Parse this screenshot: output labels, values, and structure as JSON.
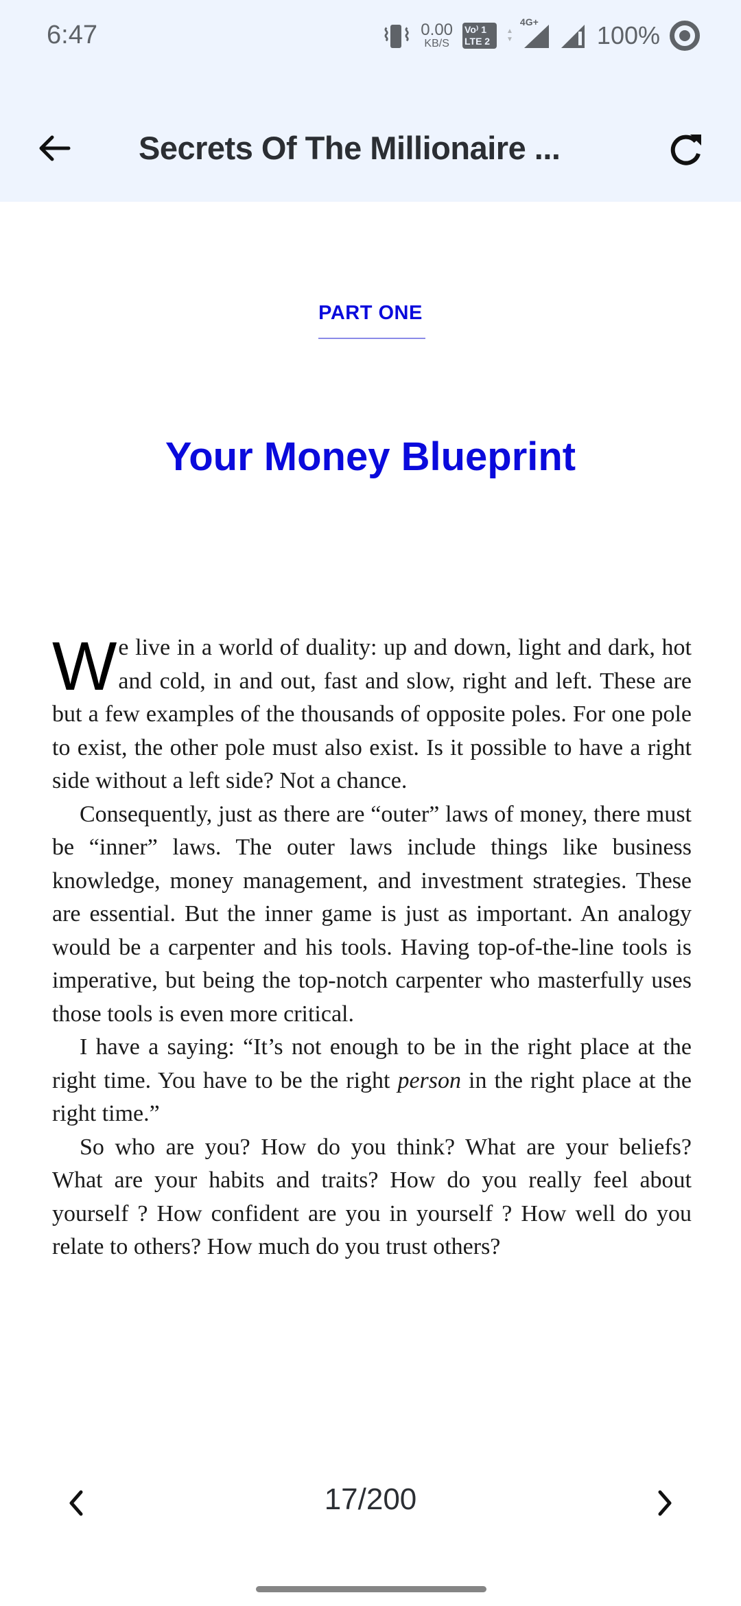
{
  "status_bar": {
    "time": "6:47",
    "net_speed_value": "0.00",
    "net_speed_unit": "KB/S",
    "volte_line1": "Vo⁾ 1",
    "volte_line2": "LTE 2",
    "network_type": "4G+",
    "battery_percent": "100%",
    "icons": [
      "vibrate-icon",
      "volte-icon",
      "data-arrows-icon",
      "signal-4g-icon",
      "signal-icon",
      "battery-saver-icon"
    ]
  },
  "app_bar": {
    "title": "Secrets Of The Millionaire ...",
    "back_icon": "arrow-left-icon",
    "refresh_icon": "refresh-icon"
  },
  "page": {
    "part_label": "PART ONE",
    "chapter_title": "Your Money Blueprint",
    "dropcap": "W",
    "paragraphs": [
      "e live in a world of duality: up and down, light and dark, hot and cold, in and out, fast and slow, right and left. These are but a few examples of the thousands of opposite poles. For one pole to exist, the other pole must also exist. Is it possible to have a right side without a left side? Not a chance.",
      "Consequently, just as there are “outer” laws of money, there must be “inner” laws. The outer laws include things like business knowledge, money management, and investment strategies. These are essential. But the inner game is just as important. An analogy would be a carpenter and his tools. Having top-of-the-line tools is imperative, but being the top-notch carpenter who masterfully uses those tools is even more critical.",
      {
        "before": "I have a saying: “It’s not enough to be in the right place at the right time. You have to be the right ",
        "italic": "person",
        "after": " in the right place at the right time.”"
      },
      "So who are you? How do you think? What are your beliefs? What are your habits and traits? How do you really feel about yourself ? How confident are you in yourself ? How well do you relate to others? How much do you trust others?"
    ]
  },
  "navigation": {
    "current_page": 17,
    "total_pages": 200,
    "page_indicator": "17/200",
    "prev_icon": "chevron-left-icon",
    "next_icon": "chevron-right-icon"
  },
  "colors": {
    "accent_blue": "#0a0adc",
    "topbar_bg": "#eef4fe",
    "title_text": "#2b2e33"
  }
}
